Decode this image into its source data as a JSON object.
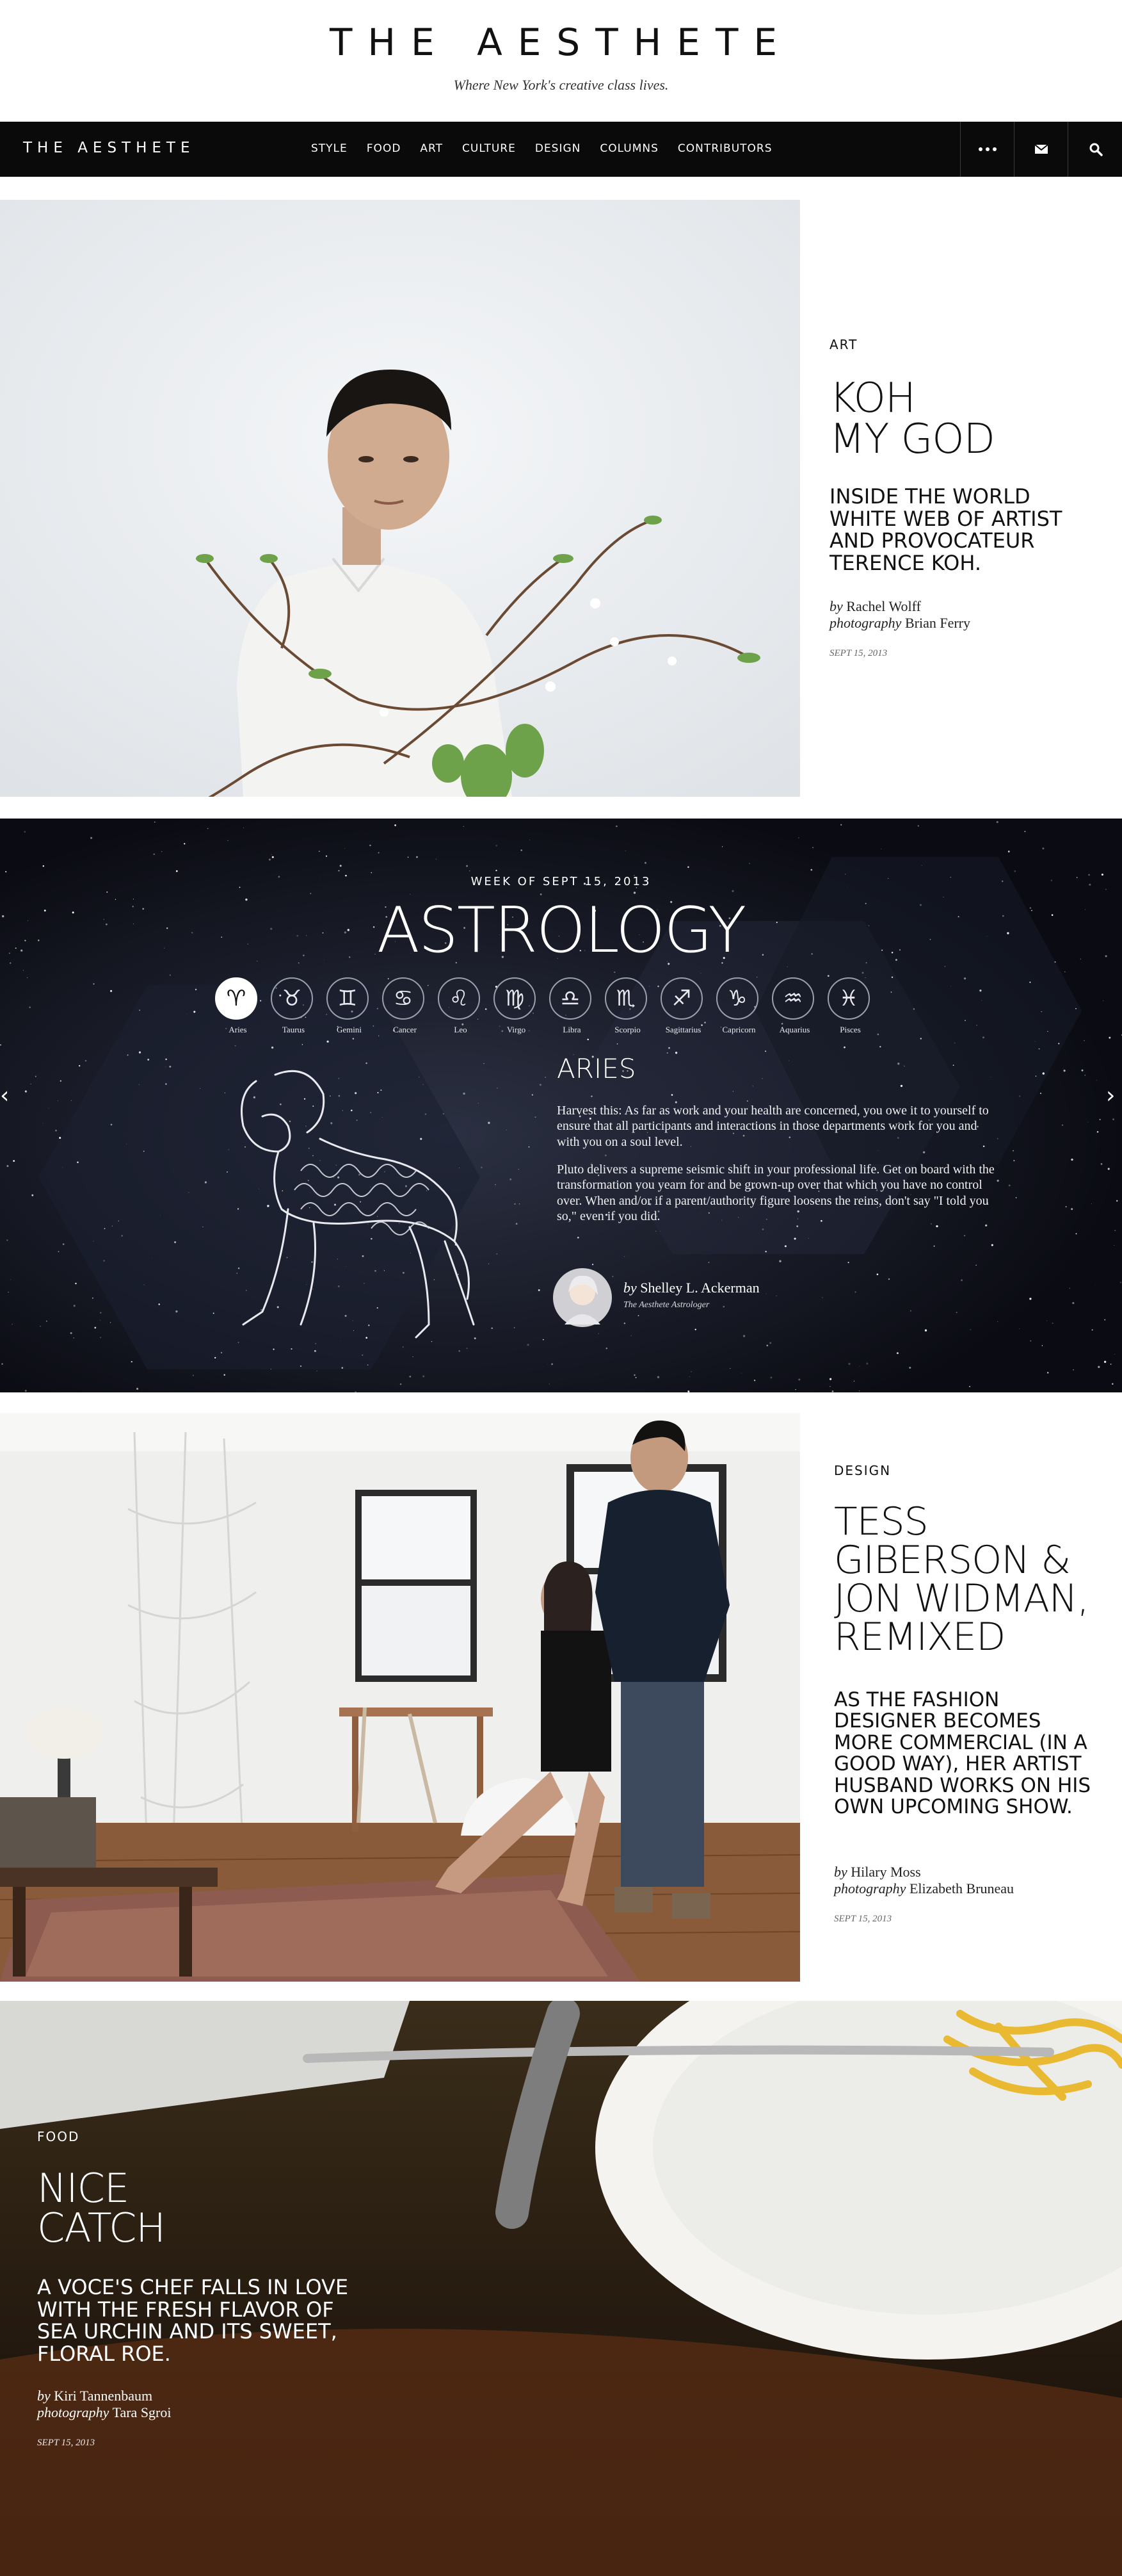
{
  "brand": {
    "title": "THE AESTHETE",
    "tagline": "Where New York's creative class lives."
  },
  "nav": {
    "logo": "THE AESTHETE",
    "links": [
      "STYLE",
      "FOOD",
      "ART",
      "CULTURE",
      "DESIGN",
      "COLUMNS",
      "CONTRIBUTORS"
    ],
    "icons": [
      "more-icon",
      "mail-icon",
      "search-icon"
    ]
  },
  "article1": {
    "kicker": "ART",
    "headline_line1": "KOH",
    "headline_line2": "MY GOD",
    "dek": "INSIDE THE WORLD WHITE WEB OF ARTIST AND PROVOCATEUR TERENCE KOH.",
    "by_prefix": "by",
    "author": "Rachel Wolff",
    "photo_prefix": "photography",
    "photographer": "Brian Ferry",
    "date": "SEPT 15, 2013"
  },
  "astrology": {
    "week": "WEEK OF SEPT 15, 2013",
    "title": "ASTROLOGY",
    "signs": [
      {
        "name": "Aries",
        "glyph": "♈"
      },
      {
        "name": "Taurus",
        "glyph": "♉"
      },
      {
        "name": "Gemini",
        "glyph": "♊"
      },
      {
        "name": "Cancer",
        "glyph": "♋"
      },
      {
        "name": "Leo",
        "glyph": "♌"
      },
      {
        "name": "Virgo",
        "glyph": "♍"
      },
      {
        "name": "Libra",
        "glyph": "♎"
      },
      {
        "name": "Scorpio",
        "glyph": "♏"
      },
      {
        "name": "Sagittarius",
        "glyph": "♐"
      },
      {
        "name": "Capricorn",
        "glyph": "♑"
      },
      {
        "name": "Aquarius",
        "glyph": "♒"
      },
      {
        "name": "Pisces",
        "glyph": "♓"
      }
    ],
    "active_sign": "ARIES",
    "paragraph1": "Harvest this: As far as work and your health are concerned, you owe it to yourself to ensure that all participants and interactions in those departments work for you and with you on a soul level.",
    "paragraph2": "Pluto delivers a supreme seismic shift in your professional life. Get on board with the transformation you yearn for and be grown-up over that which you have no control over. When and/or if a parent/authority figure loosens the reins, don't say \"I told you so,\" even if you did.",
    "by_prefix": "by",
    "author": "Shelley L. Ackerman",
    "author_title": "The Aesthete Astrologer",
    "prev_arrow": "‹",
    "next_arrow": "›"
  },
  "article3": {
    "kicker": "DESIGN",
    "headline_lines": [
      "TESS",
      "GIBERSON &",
      "JON WIDMAN,",
      "REMIXED"
    ],
    "dek": "AS THE FASHION DESIGNER BECOMES MORE COMMERCIAL (IN A GOOD WAY), HER ARTIST HUSBAND WORKS ON HIS OWN UPCOMING SHOW.",
    "by_prefix": "by",
    "author": "Hilary Moss",
    "photo_prefix": "photography",
    "photographer": "Elizabeth Bruneau",
    "date": "SEPT 15, 2013"
  },
  "article4": {
    "kicker": "FOOD",
    "headline_line1": "NICE",
    "headline_line2": "CATCH",
    "dek": "A VOCE'S CHEF FALLS IN LOVE WITH THE FRESH FLAVOR OF SEA URCHIN AND ITS SWEET, FLORAL ROE.",
    "by_prefix": "by",
    "author": "Kiri Tannenbaum",
    "photo_prefix": "photography",
    "photographer": "Tara Sgroi",
    "date": "SEPT 15, 2013"
  }
}
